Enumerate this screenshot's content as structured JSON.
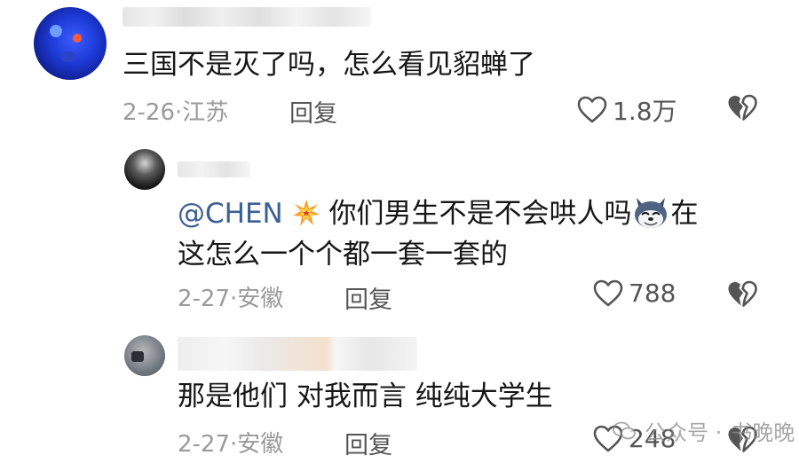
{
  "comments": [
    {
      "text": "三国不是灭了吗，怎么看见貂蝉了",
      "date": "2-26",
      "location": "江苏",
      "reply_label": "回复",
      "likes": "1.8万"
    },
    {
      "mention": "@CHEN",
      "text_a": "你们男生不是不会哄人吗",
      "text_b": "在",
      "text_line2": "这怎么一个个都一套一套的",
      "date": "2-27",
      "location": "安徽",
      "reply_label": "回复",
      "likes": "788"
    },
    {
      "text": "那是他们 对我而言 纯纯大学生",
      "date": "2-27",
      "location": "安徽",
      "reply_label": "回复",
      "likes": "248"
    }
  ],
  "separator": "·",
  "watermark": {
    "prefix": "公众号 ·",
    "name": "书晚晚"
  },
  "icons": {
    "like": "heart-outline-icon",
    "dislike": "broken-heart-icon",
    "mention_emoji": "collision-emoji",
    "inline_emoji": "husky-emoji"
  }
}
